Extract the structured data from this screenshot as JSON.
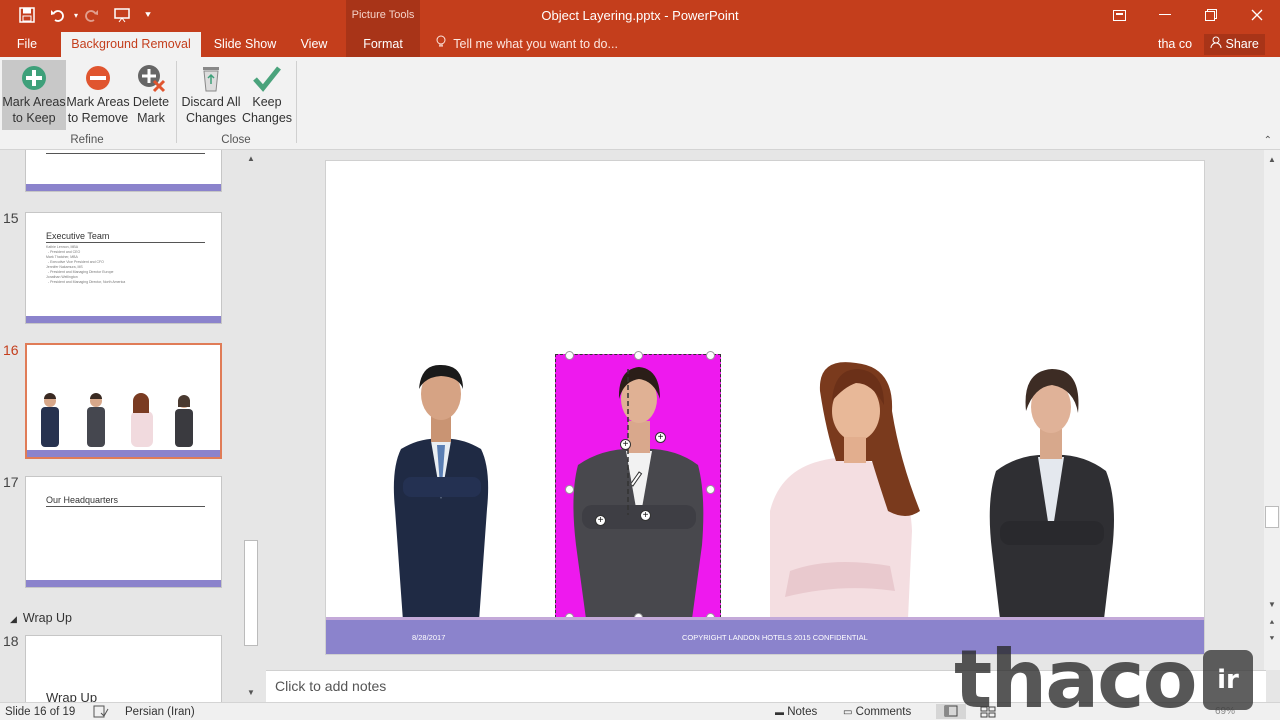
{
  "window": {
    "title": "Object Layering.pptx - PowerPoint",
    "context_group": "Picture Tools",
    "controls": [
      "ribbon-display-icon",
      "minimize-icon",
      "restore-icon",
      "close-icon"
    ]
  },
  "quick_access": [
    "save-icon",
    "undo-icon",
    "redo-icon",
    "present-icon",
    "customize-icon"
  ],
  "tabs": {
    "file": "File",
    "background_removal": "Background Removal",
    "slide_show": "Slide Show",
    "view": "View",
    "format": "Format",
    "tell_me": "Tell me what you want to do...",
    "user": "tha co",
    "share": "Share"
  },
  "ribbon": {
    "buttons": [
      {
        "line1": "Mark Areas",
        "line2": "to Keep"
      },
      {
        "line1": "Mark Areas",
        "line2": "to Remove"
      },
      {
        "line1": "Delete",
        "line2": "Mark"
      },
      {
        "line1": "Discard All",
        "line2": "Changes"
      },
      {
        "line1": "Keep",
        "line2": "Changes"
      }
    ],
    "groups": {
      "refine": "Refine",
      "close": "Close"
    }
  },
  "slides_panel": {
    "slide_numbers": {
      "s15": "15",
      "s16": "16",
      "s17": "17",
      "s18": "18"
    },
    "slide15_title": "Executive Team",
    "slide15_body": "Kathie Lennon, MBA\n  - President and CEO\nMark Thatcher, MBA\n  - Executive Vice President and CFO\nJennifer Nakamura, MS\n  - President and Managing Director Europe\nJonathan Wellington\n  - President and Managing Director, North America",
    "slide17_title": "Our Headquarters",
    "section": "Wrap Up",
    "slide18_title": "Wrap Up"
  },
  "slide": {
    "footer_date": "8/28/2017",
    "footer_copyright": "COPYRIGHT LANDON HOTELS 2015 CONFIDENTIAL"
  },
  "notes": {
    "placeholder": "Click to add notes"
  },
  "status": {
    "slide_counter": "Slide 16 of 19",
    "language": "Persian (Iran)",
    "notes": "Notes",
    "comments": "Comments",
    "zoom": "69%"
  },
  "watermark": {
    "main": "thaco",
    "badge": "ir"
  },
  "colors": {
    "accent": "#c43e1c",
    "magenta_removal": "#ee19ee",
    "footer_band": "#8b83cc"
  }
}
